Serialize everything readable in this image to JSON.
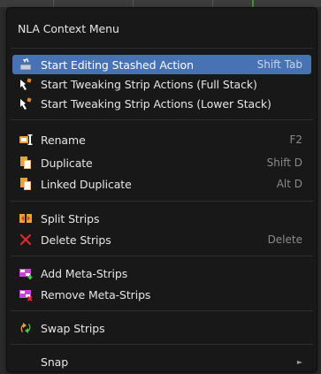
{
  "menu": {
    "title": "NLA Context Menu",
    "items": [
      {
        "label": "Start Editing Stashed Action",
        "shortcut": "Shift Tab",
        "icon": "stashed-action-icon"
      },
      {
        "label": "Start Tweaking Strip Actions (Full Stack)",
        "shortcut": "",
        "icon": "tweak-strip-icon"
      },
      {
        "label": "Start Tweaking Strip Actions (Lower Stack)",
        "shortcut": "",
        "icon": "tweak-strip-icon"
      },
      {
        "label": "Rename",
        "shortcut": "F2",
        "icon": "rename-icon"
      },
      {
        "label": "Duplicate",
        "shortcut": "Shift D",
        "icon": "duplicate-icon"
      },
      {
        "label": "Linked Duplicate",
        "shortcut": "Alt D",
        "icon": "duplicate-icon"
      },
      {
        "label": "Split Strips",
        "shortcut": "",
        "icon": "split-icon"
      },
      {
        "label": "Delete Strips",
        "shortcut": "Delete",
        "icon": "delete-x-icon"
      },
      {
        "label": "Add Meta-Strips",
        "shortcut": "",
        "icon": "add-meta-strip-icon"
      },
      {
        "label": "Remove Meta-Strips",
        "shortcut": "",
        "icon": "remove-meta-strip-icon"
      },
      {
        "label": "Swap Strips",
        "shortcut": "",
        "icon": "swap-icon"
      },
      {
        "label": "Snap",
        "shortcut": "",
        "icon": ""
      }
    ],
    "submenu_arrow": "►"
  },
  "colors": {
    "menu_bg": "#181818",
    "highlight": "#4772b3",
    "text": "#e5e5e5",
    "shortcut_text": "#8a8a8a"
  }
}
